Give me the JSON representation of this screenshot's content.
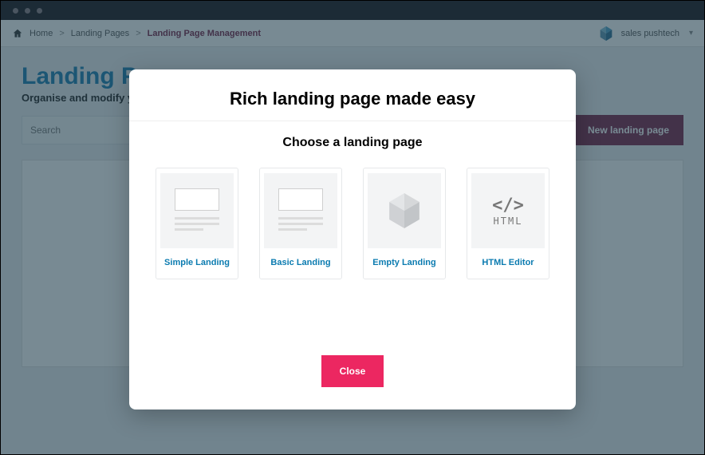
{
  "breadcrumb": {
    "items": [
      "Home",
      "Landing Pages",
      "Landing Page Management"
    ]
  },
  "user": {
    "name": "sales pushtech"
  },
  "page": {
    "title": "Landing Pages",
    "subtitle": "Organise and modify your landing pages"
  },
  "search": {
    "placeholder": "Search"
  },
  "toolbar": {
    "new_label": "New landing page"
  },
  "modal": {
    "title": "Rich landing page made easy",
    "subtitle": "Choose a landing page",
    "close_label": "Close",
    "templates": [
      {
        "label": "Simple Landing"
      },
      {
        "label": "Basic Landing"
      },
      {
        "label": "Empty Landing"
      },
      {
        "label": "HTML Editor"
      }
    ]
  }
}
